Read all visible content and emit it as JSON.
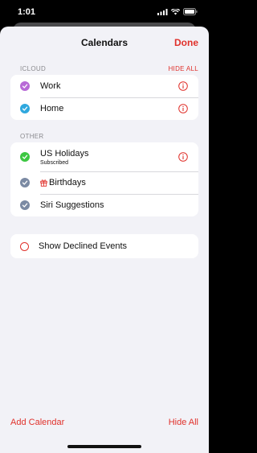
{
  "status_bar": {
    "time": "1:01"
  },
  "nav": {
    "title": "Calendars",
    "done_label": "Done"
  },
  "icloud": {
    "header": "ICLOUD",
    "hide_all": "HIDE ALL",
    "items": [
      {
        "label": "Work",
        "color": "#b86ad6"
      },
      {
        "label": "Home",
        "color": "#2fa8de"
      }
    ]
  },
  "other": {
    "header": "OTHER",
    "items": [
      {
        "label": "US Holidays",
        "sub": "Subscribed",
        "color": "#3dc742"
      },
      {
        "label": "Birthdays",
        "color": "#7b8aa3"
      },
      {
        "label": "Siri Suggestions",
        "color": "#7b8aa3"
      }
    ]
  },
  "decline": {
    "label": "Show Declined Events"
  },
  "bottom": {
    "add_label": "Add Calendar",
    "hide_label": "Hide All"
  },
  "colors": {
    "accent": "#e0312b",
    "background": "#f2f2f7"
  },
  "icons": [
    "signal-icon",
    "wifi-icon",
    "battery-icon",
    "checkmark-icon",
    "info-icon",
    "gift-icon"
  ]
}
